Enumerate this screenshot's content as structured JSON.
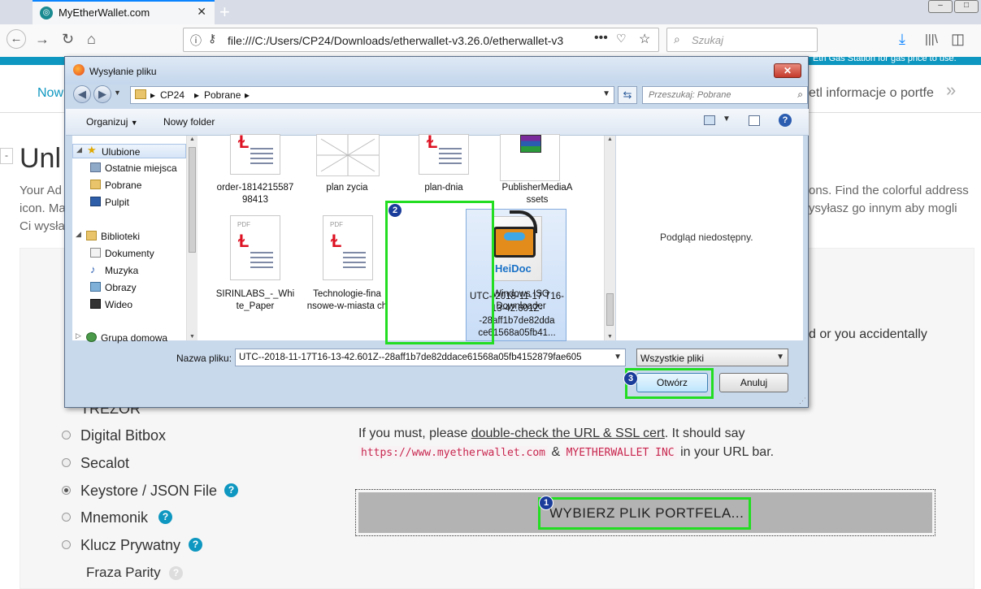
{
  "browser": {
    "tab_title": "MyEtherWallet.com",
    "url": "file:///C:/Users/CP24/Downloads/etherwallet-v3.26.0/etherwallet-v3",
    "search_placeholder": "Szukaj"
  },
  "page": {
    "top_notice": "Eth Gas Station for gas price to use.",
    "nav_left": "Now",
    "nav_right": "etl informacje o portfe",
    "heading": "Unl",
    "intro_line1_left": "Your Ad",
    "intro_line1_right": "ons. Find the colorful address",
    "intro_line2_left": "icon. Ma",
    "intro_line2_right": "ysyłasz go innym aby mogli",
    "intro_line3_left": "Ci wysła",
    "side_text": "d or you accidentally",
    "options": [
      {
        "label": "TREZOR",
        "selected": false,
        "help": false
      },
      {
        "label": "Digital Bitbox",
        "selected": false,
        "help": false
      },
      {
        "label": "Secalot",
        "selected": false,
        "help": false
      },
      {
        "label": "Keystore / JSON File",
        "selected": true,
        "help": true
      },
      {
        "label": "Mnemonik",
        "selected": false,
        "help": true
      },
      {
        "label": "Klucz Prywatny",
        "selected": false,
        "help": true
      },
      {
        "label": "Fraza Parity",
        "selected": false,
        "help": true
      }
    ],
    "caution_prefix": "If you must, please ",
    "caution_link": "double-check the URL & SSL cert",
    "caution_suffix": ". It should say",
    "url_code": "https://www.myetherwallet.com",
    "amp": "&",
    "company_code": "MYETHERWALLET INC",
    "url_suffix": "in your URL bar.",
    "select_file_button": "WYBIERZ PLIK PORTFELA..."
  },
  "dialog": {
    "title": "Wysyłanie pliku",
    "path": [
      "CP24",
      "Pobrane"
    ],
    "search_placeholder": "Przeszukaj: Pobrane",
    "organize": "Organizuj",
    "new_folder": "Nowy folder",
    "nav_items": [
      {
        "label": "Ulubione",
        "icon": "star-icon",
        "selected": true
      },
      {
        "label": "Ostatnie miejsca",
        "icon": "recent-places-icon"
      },
      {
        "label": "Pobrane",
        "icon": "downloads-folder-icon"
      },
      {
        "label": "Pulpit",
        "icon": "desktop-icon"
      },
      {
        "label": "Biblioteki",
        "icon": "libraries-icon"
      },
      {
        "label": "Dokumenty",
        "icon": "documents-icon"
      },
      {
        "label": "Muzyka",
        "icon": "music-icon"
      },
      {
        "label": "Obrazy",
        "icon": "pictures-icon"
      },
      {
        "label": "Wideo",
        "icon": "video-icon"
      },
      {
        "label": "Grupa domowa",
        "icon": "homegroup-icon"
      }
    ],
    "files": [
      {
        "name": "order-1814215587 98413"
      },
      {
        "name": "plan zycia"
      },
      {
        "name": "plan-dnia"
      },
      {
        "name": "PublisherMediaA ssets"
      },
      {
        "name": "SIRINLABS_-_Whi te_Paper"
      },
      {
        "name": "Technologie-fina nsowe-w-miasta ch"
      },
      {
        "name": "UTC--2018-11-17 T16-13-42.601Z--28aff1b7de82dda ce61568a05fb41..."
      },
      {
        "name": "Windows ISO Downloader"
      }
    ],
    "pdf_mark": "PDF",
    "heidoc_label": "HeiDoc",
    "preview_text": "Podgląd niedostępny.",
    "filename_label": "Nazwa pliku:",
    "filename_value": "UTC--2018-11-17T16-13-42.601Z--28aff1b7de82ddace61568a05fb4152879fae605",
    "filter_value": "Wszystkie pliki",
    "open_button": "Otwórz",
    "cancel_button": "Anuluj"
  },
  "annotations": {
    "badge1": "1",
    "badge2": "2",
    "badge3": "3",
    "highlight_color": "#22dd22",
    "badge_color": "#1a3c9a"
  },
  "colors": {
    "accent": "#0e97c0"
  }
}
